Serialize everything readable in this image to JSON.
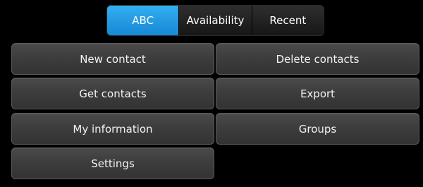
{
  "tabs": [
    {
      "label": "ABC",
      "active": true
    },
    {
      "label": "Availability",
      "active": false
    },
    {
      "label": "Recent",
      "active": false
    }
  ],
  "menu": {
    "new_contact": "New contact",
    "delete_contacts": "Delete contacts",
    "get_contacts": "Get contacts",
    "export": "Export",
    "my_information": "My information",
    "groups": "Groups",
    "settings": "Settings"
  },
  "colors": {
    "active_tab": "#1f97e3",
    "button_bg": "#3e3e3e",
    "background": "#000000",
    "text": "#ffffff"
  }
}
